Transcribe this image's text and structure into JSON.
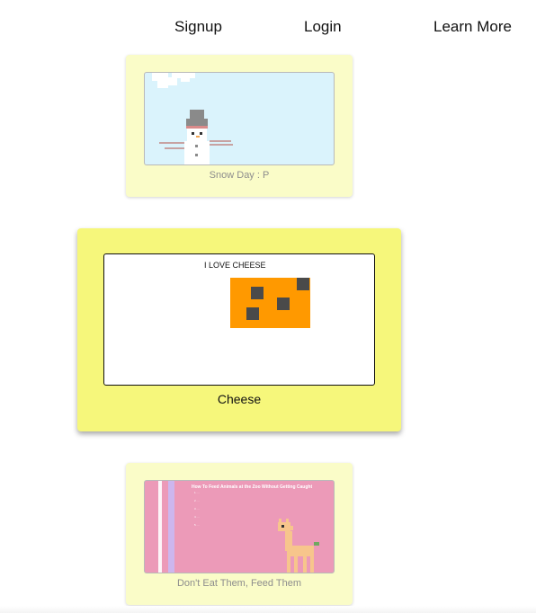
{
  "nav": {
    "signup": "Signup",
    "login": "Login",
    "learn_more": "Learn More"
  },
  "cards": [
    {
      "caption": "Snow Day : P",
      "scene": "snowman-pixel-art"
    },
    {
      "caption": "Cheese",
      "frame_text": "I LOVE CHEESE",
      "scene": "cheese-block"
    },
    {
      "caption": "Don't Eat Them, Feed Them",
      "scene": "zoo-llama",
      "thumb_title": "How To Feed Animals at the Zoo Without Getting Caught",
      "thumb_list": [
        "1. ...",
        "2. ...",
        "3. ...",
        "4. ...",
        "5. ..."
      ]
    }
  ],
  "colors": {
    "card_bg": "#fafcc8",
    "card_active_bg": "#f6f77b",
    "cheese": "#ff9900",
    "cheese_hole": "#4a4a4a",
    "snow_sky": "#daf3fc",
    "zoo_bg": "#ec9ab8",
    "llama": "#f7c58c"
  }
}
